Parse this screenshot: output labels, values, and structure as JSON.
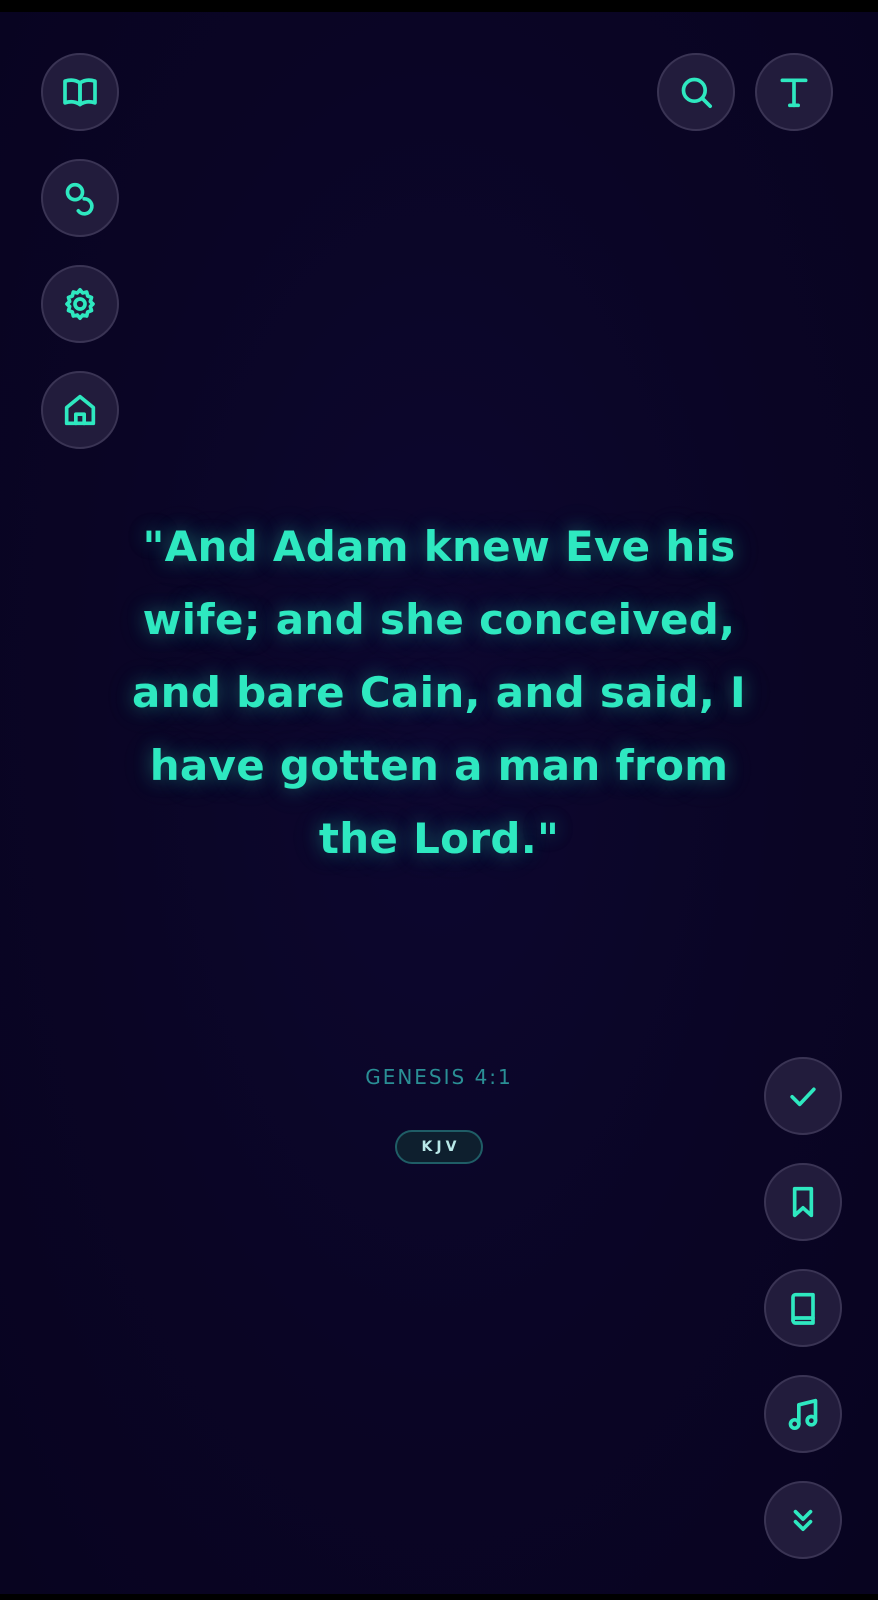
{
  "colors": {
    "background": "#0a0525",
    "accent": "#2ee8c0",
    "button_fill": "#221c3c",
    "reference_text": "#2a8f95"
  },
  "left_toolbar": [
    {
      "name": "book-open-icon",
      "icon": "open-book"
    },
    {
      "name": "circles-icon",
      "icon": "two-circles"
    },
    {
      "name": "gear-icon",
      "icon": "settings-gear"
    },
    {
      "name": "home-icon",
      "icon": "house"
    }
  ],
  "top_right_toolbar": [
    {
      "name": "search-icon",
      "icon": "magnifier"
    },
    {
      "name": "text-size-icon",
      "icon": "letter-T"
    }
  ],
  "right_toolbar": [
    {
      "name": "check-icon",
      "icon": "checkmark"
    },
    {
      "name": "bookmark-icon",
      "icon": "bookmark"
    },
    {
      "name": "book-icon",
      "icon": "closed-book"
    },
    {
      "name": "music-icon",
      "icon": "music-note"
    },
    {
      "name": "chevrons-down-icon",
      "icon": "double-chevron-down"
    }
  ],
  "verse": {
    "text": "\"And Adam knew Eve his wife; and she conceived, and bare Cain, and said, I have gotten a man from the Lord.\"",
    "reference": "GENESIS 4:1",
    "version": "KJV"
  }
}
